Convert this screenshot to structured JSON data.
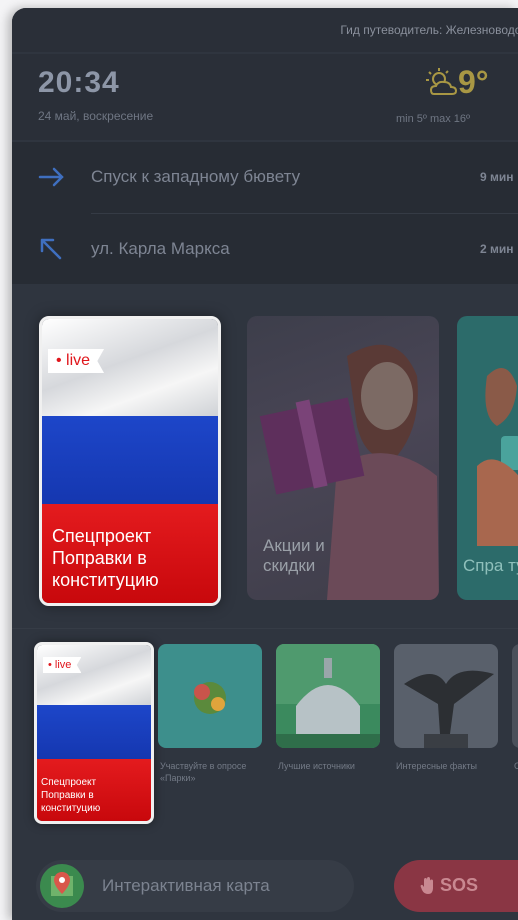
{
  "header": {
    "title": "Гид путеводитель: Железноводск"
  },
  "clock": {
    "time": "20:34",
    "date": "24 май, воскресение"
  },
  "weather": {
    "temp": "9°",
    "minmax": "min 5º  max 16º",
    "icon": "partly-cloudy-icon"
  },
  "route": [
    {
      "label": "Спуск к западному бювету",
      "minutes": "9 мин",
      "icon": "arrow-right-icon"
    },
    {
      "label": "ул. Карла Маркса",
      "minutes": "2 мин",
      "icon": "arrow-up-left-icon"
    }
  ],
  "stories": [
    {
      "badge": "• live",
      "title": "Спецпроект Поправки в конституцию"
    },
    {
      "title": "Акции и скидки"
    },
    {
      "title": "Спра тури"
    }
  ],
  "thumbs": [
    {
      "badge": "• live",
      "title": "Спецпроект Поправки в конституцию"
    },
    {
      "caption": "Участвуйте в опросе «Парки»"
    },
    {
      "caption": "Лучшие источники"
    },
    {
      "caption": "Интересные факты"
    },
    {
      "caption": "С"
    }
  ],
  "bottom": {
    "map_label": "Интерактивная карта",
    "sos_label": "SOS"
  },
  "colors": {
    "background": "#2f353f",
    "accent_red": "#e41b1e",
    "accent_blue": "#1d46c9",
    "sos": "#8a3644"
  }
}
